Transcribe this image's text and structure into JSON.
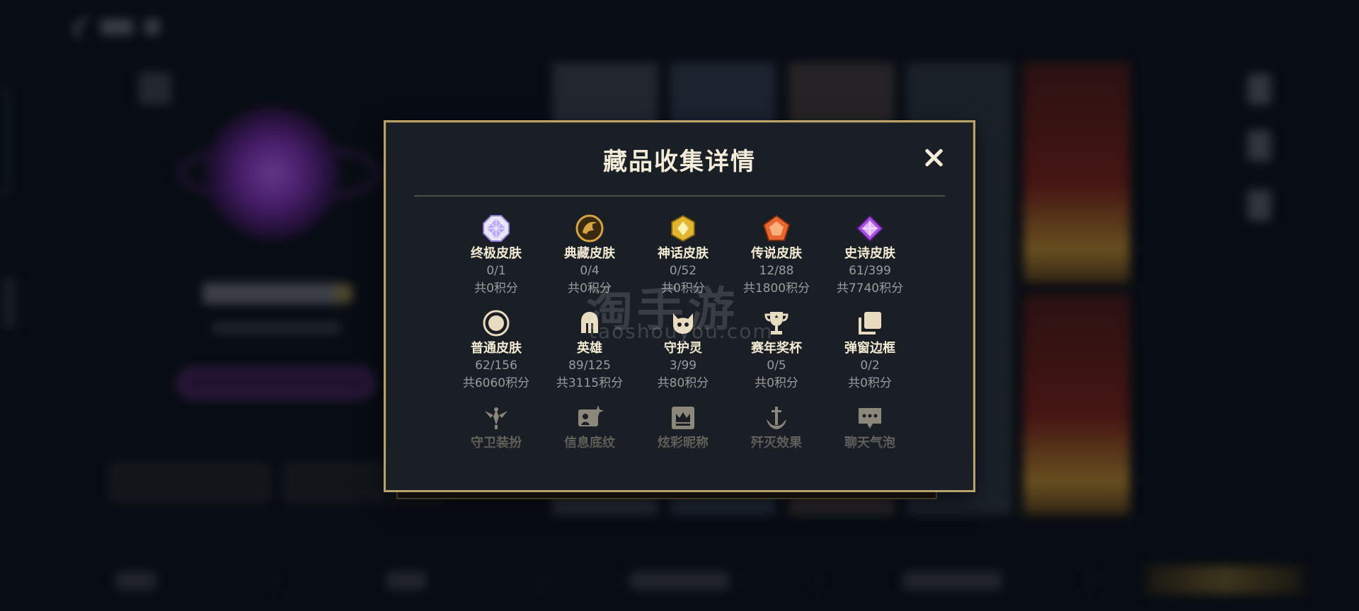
{
  "dialog": {
    "title": "藏品收集详情",
    "close_icon": "close-icon"
  },
  "collection": [
    {
      "name": "终极皮肤",
      "count": "0/1",
      "points": "共0积分",
      "icon": "crystal-octagon-icon",
      "color": "#b9a8ff"
    },
    {
      "name": "典藏皮肤",
      "count": "0/4",
      "points": "共0积分",
      "icon": "dragon-emblem-icon",
      "color": "#d6a541"
    },
    {
      "name": "神话皮肤",
      "count": "0/52",
      "points": "共0积分",
      "icon": "gold-hexagon-icon",
      "color": "#e2b530"
    },
    {
      "name": "传说皮肤",
      "count": "12/88",
      "points": "共1800积分",
      "icon": "orange-pentagon-icon",
      "color": "#e8672e"
    },
    {
      "name": "史诗皮肤",
      "count": "61/399",
      "points": "共7740积分",
      "icon": "purple-diamond-icon",
      "color": "#a64fe0"
    },
    {
      "name": "普通皮肤",
      "count": "62/156",
      "points": "共6060积分",
      "icon": "circle-icon",
      "color": "#e8dcc0"
    },
    {
      "name": "英雄",
      "count": "89/125",
      "points": "共3115积分",
      "icon": "helmet-icon",
      "color": "#e8dcc0"
    },
    {
      "name": "守护灵",
      "count": "3/99",
      "points": "共80积分",
      "icon": "spirit-pet-icon",
      "color": "#e8dcc0"
    },
    {
      "name": "赛年奖杯",
      "count": "0/5",
      "points": "共0积分",
      "icon": "trophy-icon",
      "color": "#e8dcc0"
    },
    {
      "name": "弹窗边框",
      "count": "0/2",
      "points": "共0积分",
      "icon": "frames-icon",
      "color": "#e8dcc0"
    },
    {
      "name": "守卫装扮",
      "count": "",
      "points": "",
      "icon": "ward-icon",
      "color": "#e8dcc0"
    },
    {
      "name": "信息底纹",
      "count": "",
      "points": "",
      "icon": "card-sparkle-icon",
      "color": "#e8dcc0"
    },
    {
      "name": "炫彩昵称",
      "count": "",
      "points": "",
      "icon": "crown-badge-icon",
      "color": "#e8dcc0"
    },
    {
      "name": "歼灭效果",
      "count": "",
      "points": "",
      "icon": "anchor-sword-icon",
      "color": "#e8dcc0"
    },
    {
      "name": "聊天气泡",
      "count": "",
      "points": "",
      "icon": "chat-bubble-icon",
      "color": "#e8dcc0"
    }
  ],
  "watermark": {
    "text": "淘手游",
    "sub": "taoshouyou.com"
  }
}
